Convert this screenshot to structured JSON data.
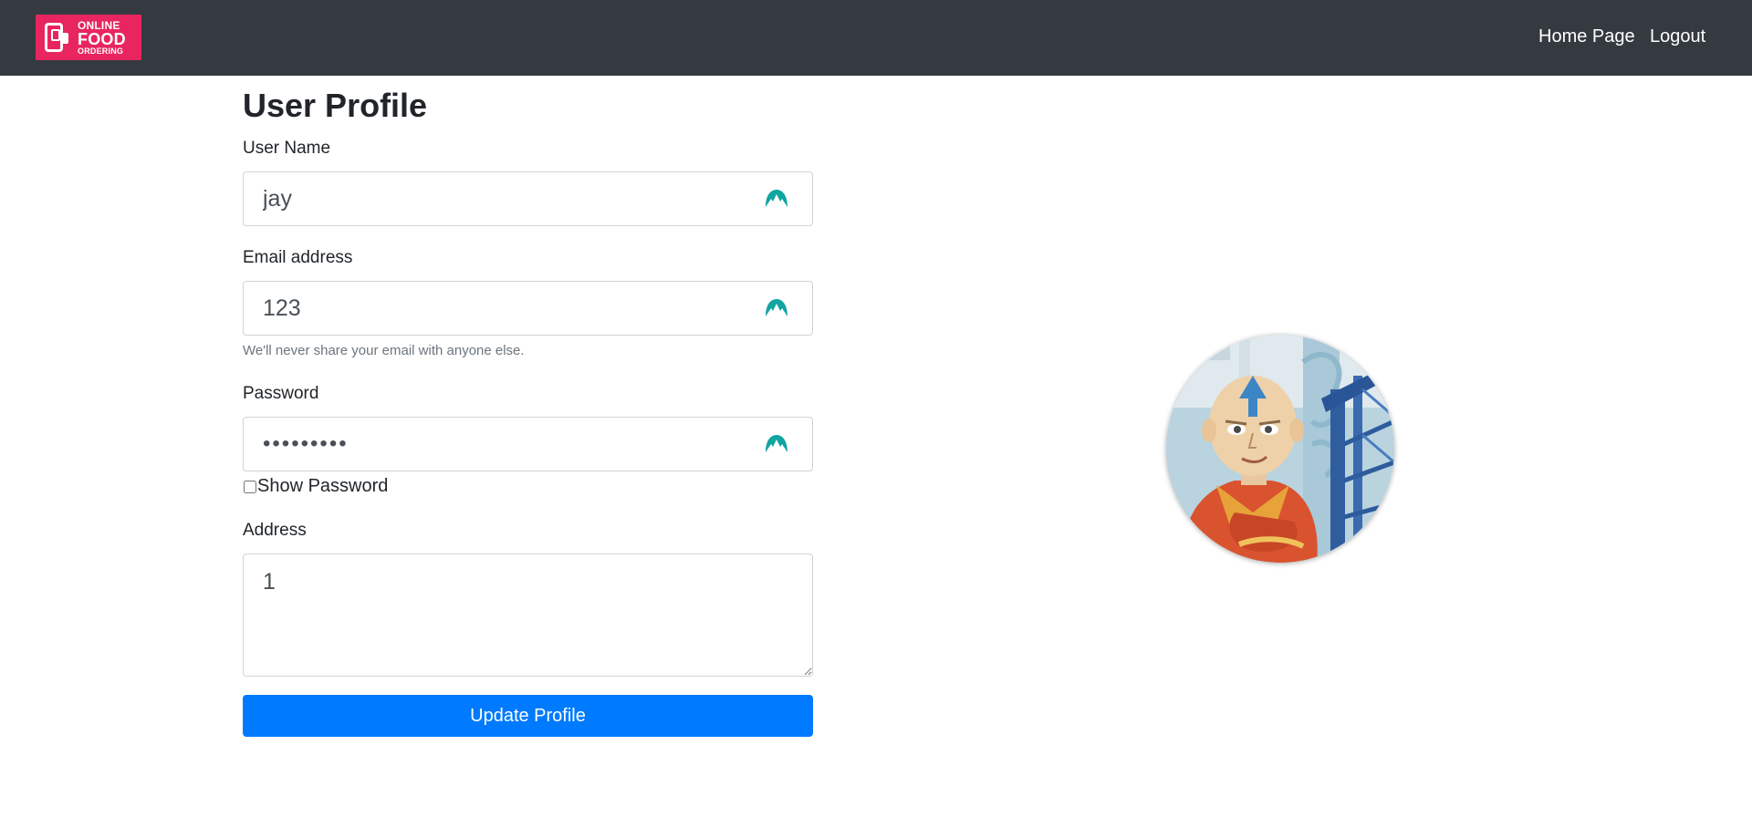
{
  "navbar": {
    "logo": {
      "line1": "ONLINE",
      "line2": "FOOD",
      "line3": "ORDERING",
      "bg_color": "#e8255f"
    },
    "links": {
      "home": "Home Page",
      "logout": "Logout"
    },
    "bg_color": "#343a40"
  },
  "page": {
    "title": "User Profile"
  },
  "form": {
    "username": {
      "label": "User Name",
      "value": "jay",
      "icon": "nordpass-autofill-icon"
    },
    "email": {
      "label": "Email address",
      "value": "123",
      "help": "We'll never share your email with anyone else.",
      "icon": "nordpass-autofill-icon"
    },
    "password": {
      "label": "Password",
      "value": "123456789",
      "icon": "nordpass-autofill-icon",
      "show_password_label": "Show Password"
    },
    "address": {
      "label": "Address",
      "value": "1"
    },
    "submit_label": "Update Profile"
  },
  "profile_image": {
    "icon": "profile-avatar"
  },
  "colors": {
    "primary": "#007bff",
    "icon_teal": "#10a5a1"
  }
}
